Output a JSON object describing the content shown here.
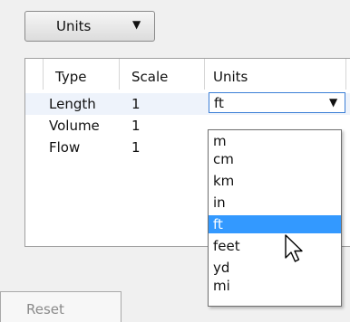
{
  "units_button": {
    "label": "Units",
    "icon": "chevron-down-icon"
  },
  "table": {
    "columns": [
      "Type",
      "Scale",
      "Units"
    ],
    "rows": [
      {
        "type": "Length",
        "scale": "1",
        "units": "ft"
      },
      {
        "type": "Volume",
        "scale": "1",
        "units": ""
      },
      {
        "type": "Flow",
        "scale": "1",
        "units": ""
      }
    ]
  },
  "units_combo": {
    "value": "ft",
    "icon": "chevron-down-icon"
  },
  "unit_options": {
    "items": [
      "m",
      "cm",
      "km",
      "in",
      "ft",
      "feet",
      "yd",
      "mi"
    ],
    "highlighted": "ft"
  },
  "reset_tab": {
    "label": "Reset"
  },
  "colors": {
    "highlight": "#3399ff",
    "selected_row": "#eef3fb",
    "focus_border": "#3c7fd6"
  }
}
